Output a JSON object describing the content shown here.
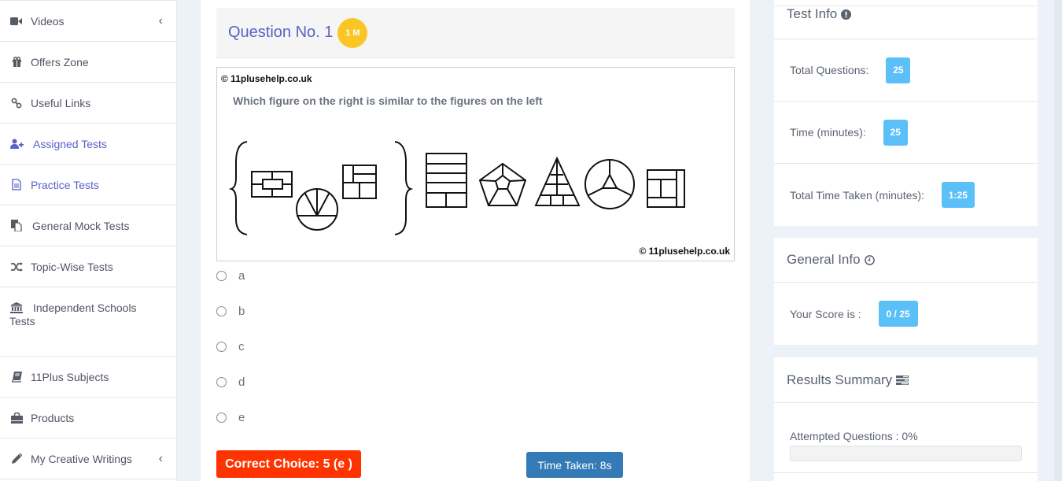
{
  "sidebar": {
    "items": [
      {
        "label": "Videos",
        "icon": "video-icon",
        "has_chevron": true,
        "active": false
      },
      {
        "label": "Offers Zone",
        "icon": "gift-icon",
        "has_chevron": false,
        "active": false
      },
      {
        "label": "Useful Links",
        "icon": "link-icon",
        "has_chevron": false,
        "active": false
      },
      {
        "label": "Assigned Tests",
        "icon": "user-plus-icon",
        "has_chevron": false,
        "active": true
      },
      {
        "label": "Practice Tests",
        "icon": "file-text-icon",
        "has_chevron": false,
        "active": true
      },
      {
        "label": "General Mock Tests",
        "icon": "files-icon",
        "has_chevron": false,
        "active": false
      },
      {
        "label": "Topic-Wise Tests",
        "icon": "shuffle-icon",
        "has_chevron": false,
        "active": false
      },
      {
        "label": "Independent Schools",
        "label_line2": "Tests",
        "icon": "bank-icon",
        "has_chevron": false,
        "active": false
      },
      {
        "label": "11Plus Subjects",
        "icon": "book-icon",
        "has_chevron": false,
        "active": false
      },
      {
        "label": "Products",
        "icon": "shopping-bag-icon",
        "has_chevron": false,
        "active": false
      },
      {
        "label": "My Creative Writings",
        "icon": "pencil-icon",
        "has_chevron": true,
        "active": false
      }
    ],
    "chevron_glyph": "‹"
  },
  "question": {
    "title": "Question No. 1",
    "marks_badge": "1 M",
    "copyright": "© 11plusehelp.co.uk",
    "text": "Which figure on the right is similar to the figures on the left",
    "figure_description": {
      "left_group": [
        "rectangle with inner rectangle",
        "circle with fan lines",
        "square split into sections"
      ],
      "right_options": [
        "stacked rectangle",
        "pentagon within pentagon",
        "divided triangle",
        "circle with inner triangle",
        "square with inner sections"
      ]
    },
    "options": [
      "a",
      "b",
      "c",
      "d",
      "e"
    ],
    "selected_option": null,
    "correct_choice_label": "Correct Choice: 5 (e )",
    "time_taken_label": "Time Taken: 8s"
  },
  "test_info": {
    "title": "Test Info",
    "title_icon": "exclamation-circle-icon",
    "rows": [
      {
        "label": "Total Questions:",
        "value": "25"
      },
      {
        "label": "Time (minutes):",
        "value": "25"
      },
      {
        "label": "Total Time Taken (minutes):",
        "value": "1:25"
      }
    ]
  },
  "general_info": {
    "title": "General Info",
    "title_icon": "clock-icon",
    "score_label": "Your Score is :",
    "score_value": "0 / 25"
  },
  "results_summary": {
    "title": "Results Summary",
    "title_icon": "tasks-icon",
    "attempted_label": "Attempted Questions : 0%",
    "attempted_percent": 0
  },
  "colors": {
    "accent_purple": "#5b5fc7",
    "badge_yellow": "#f9c623",
    "badge_blue": "#5bc0f8",
    "correct_red": "#ff3300",
    "time_blue": "#337ab7",
    "page_bg": "#edf1f8"
  }
}
